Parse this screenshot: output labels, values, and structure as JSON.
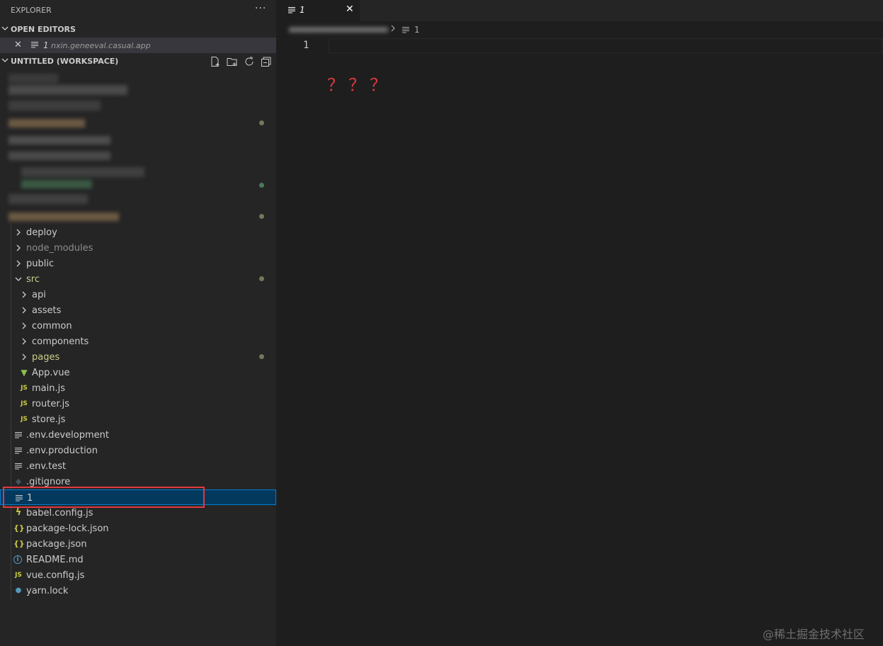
{
  "sidebar": {
    "title": "EXPLORER",
    "more_label": "···",
    "open_editors": {
      "header": "OPEN EDITORS",
      "items": [
        {
          "name": "1",
          "path": "nxin.geneeval.casual.app"
        }
      ]
    },
    "workspace": {
      "header": "UNTITLED (WORKSPACE)",
      "actions": [
        "new-file-icon",
        "new-folder-icon",
        "refresh-icon",
        "collapse-all-icon"
      ]
    },
    "tree": [
      {
        "name": "deploy",
        "kind": "folder",
        "state": "collapsed"
      },
      {
        "name": "node_modules",
        "kind": "folder",
        "state": "collapsed",
        "dim": true
      },
      {
        "name": "public",
        "kind": "folder",
        "state": "collapsed"
      },
      {
        "name": "src",
        "kind": "folder",
        "state": "expanded",
        "modified": true
      },
      {
        "name": "api",
        "kind": "folder",
        "state": "collapsed"
      },
      {
        "name": "assets",
        "kind": "folder",
        "state": "collapsed"
      },
      {
        "name": "common",
        "kind": "folder",
        "state": "collapsed"
      },
      {
        "name": "components",
        "kind": "folder",
        "state": "collapsed"
      },
      {
        "name": "pages",
        "kind": "folder",
        "state": "collapsed",
        "modified": true
      },
      {
        "name": "App.vue",
        "kind": "vue"
      },
      {
        "name": "main.js",
        "kind": "js",
        "icon_text": "JS"
      },
      {
        "name": "router.js",
        "kind": "js",
        "icon_text": "JS"
      },
      {
        "name": "store.js",
        "kind": "js",
        "icon_text": "JS"
      },
      {
        "name": ".env.development",
        "kind": "text"
      },
      {
        "name": ".env.production",
        "kind": "text"
      },
      {
        "name": ".env.test",
        "kind": "text"
      },
      {
        "name": ".gitignore",
        "kind": "git"
      },
      {
        "name": "1",
        "kind": "text",
        "selected": true
      },
      {
        "name": "babel.config.js",
        "kind": "babel"
      },
      {
        "name": "package-lock.json",
        "kind": "json",
        "icon_text": "{}"
      },
      {
        "name": "package.json",
        "kind": "json",
        "icon_text": "{}"
      },
      {
        "name": "README.md",
        "kind": "info",
        "icon_text": "i"
      },
      {
        "name": "vue.config.js",
        "kind": "js",
        "icon_text": "JS"
      },
      {
        "name": "yarn.lock",
        "kind": "yarn"
      }
    ]
  },
  "editor": {
    "tab": {
      "label": "1",
      "close": "✕"
    },
    "breadcrumb": {
      "file": "1"
    },
    "line_number": "1",
    "annotation": "？？？"
  },
  "watermark": "@稀土掘金技术社区",
  "colors": {
    "modified_dot": "#73785a",
    "modified_dot_green": "#4c7a5b",
    "js_icon": "#cbcb41",
    "json_icon": "#cbcb41",
    "vue_icon": "#8dc149",
    "info_icon": "#519aba",
    "annotation": "#e0393e",
    "highlight_box": "#e0393e"
  }
}
